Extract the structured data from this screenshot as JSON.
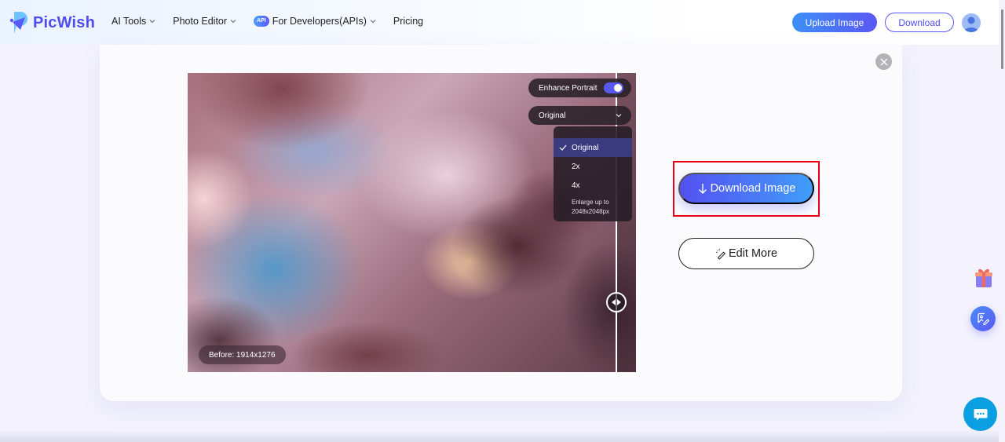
{
  "header": {
    "brand": "PicWish",
    "nav": [
      {
        "label": "AI Tools",
        "has_dropdown": true
      },
      {
        "label": "Photo Editor",
        "has_dropdown": true
      },
      {
        "label": "For Developers(APIs)",
        "has_dropdown": true,
        "badge": "API"
      },
      {
        "label": "Pricing",
        "has_dropdown": false
      }
    ],
    "upload_label": "Upload Image",
    "download_label": "Download",
    "avatar_icon": "user-avatar-icon"
  },
  "preview": {
    "enhance_label": "Enhance Portrait",
    "enhance_enabled": true,
    "scale_selected": "Original",
    "scale_options": [
      {
        "label": "Original",
        "selected": true
      },
      {
        "label": "2x",
        "selected": false
      },
      {
        "label": "4x",
        "selected": false
      }
    ],
    "scale_note_line1": "Enlarge up to",
    "scale_note_line2": "2048x2048px",
    "before_label": "Before: 1914x1276"
  },
  "actions": {
    "download_image_label": "Download Image",
    "edit_more_label": "Edit More"
  },
  "colors": {
    "brand": "#4f4ef2",
    "primary_gradient_start": "#5451f2",
    "primary_gradient_end": "#3f9ef9",
    "highlight": "#e60012",
    "chat": "#0a9fe0"
  }
}
